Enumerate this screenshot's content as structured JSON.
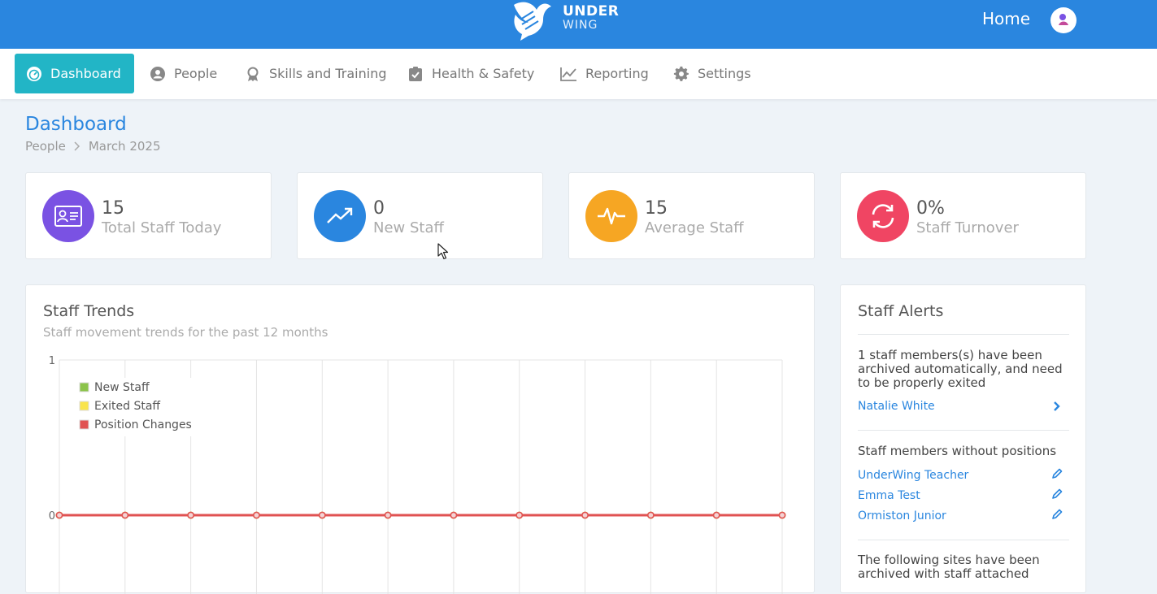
{
  "app": {
    "logo_line1": "UNDER",
    "logo_line2": "WING",
    "home_label": "Home"
  },
  "nav": {
    "items": [
      {
        "label": "Dashboard",
        "icon": "dashboard-gauge-icon",
        "active": true
      },
      {
        "label": "People",
        "icon": "user-circle-icon"
      },
      {
        "label": "Skills and Training",
        "icon": "award-ribbon-icon"
      },
      {
        "label": "Health & Safety",
        "icon": "clipboard-check-icon"
      },
      {
        "label": "Reporting",
        "icon": "line-chart-icon"
      },
      {
        "label": "Settings",
        "icon": "gear-icon"
      }
    ]
  },
  "page": {
    "title": "Dashboard",
    "breadcrumb": [
      "People",
      "March 2025"
    ]
  },
  "stats": [
    {
      "value": "15",
      "label": "Total Staff Today",
      "icon": "id-card-icon",
      "color": "#7a52e3"
    },
    {
      "value": "0",
      "label": "New Staff",
      "icon": "trend-up-icon",
      "color": "#2a86df"
    },
    {
      "value": "15",
      "label": "Average Staff",
      "icon": "pulse-icon",
      "color": "#f6a623"
    },
    {
      "value": "0%",
      "label": "Staff Turnover",
      "icon": "refresh-icon",
      "color": "#f04563"
    }
  ],
  "trends": {
    "title": "Staff Trends",
    "subtitle": "Staff movement trends for the past 12 months"
  },
  "chart_data": {
    "type": "line",
    "x": [
      "",
      "",
      "",
      "",
      "",
      "",
      "",
      "",
      "",
      "",
      "",
      ""
    ],
    "ylim": [
      0,
      1
    ],
    "y_ticks": [
      "0",
      "1"
    ],
    "grid": true,
    "legend_position": "top-left",
    "series": [
      {
        "name": "New Staff",
        "color": "#8bc34a",
        "values": [
          0,
          0,
          0,
          0,
          0,
          0,
          0,
          0,
          0,
          0,
          0,
          0
        ]
      },
      {
        "name": "Exited Staff",
        "color": "#f9e44c",
        "values": [
          0,
          0,
          0,
          0,
          0,
          0,
          0,
          0,
          0,
          0,
          0,
          0
        ]
      },
      {
        "name": "Position Changes",
        "color": "#e05252",
        "values": [
          0,
          0,
          0,
          0,
          0,
          0,
          0,
          0,
          0,
          0,
          0,
          0
        ]
      }
    ]
  },
  "alerts": {
    "title": "Staff Alerts",
    "archived_text": "1 staff members(s) have been archived automatically, and need to be properly exited",
    "archived_people": [
      "Natalie White"
    ],
    "no_position_heading": "Staff members without positions",
    "no_position_people": [
      "UnderWing Teacher",
      "Emma Test",
      "Ormiston Junior"
    ],
    "sites_text": "The following sites have been archived with staff attached"
  }
}
